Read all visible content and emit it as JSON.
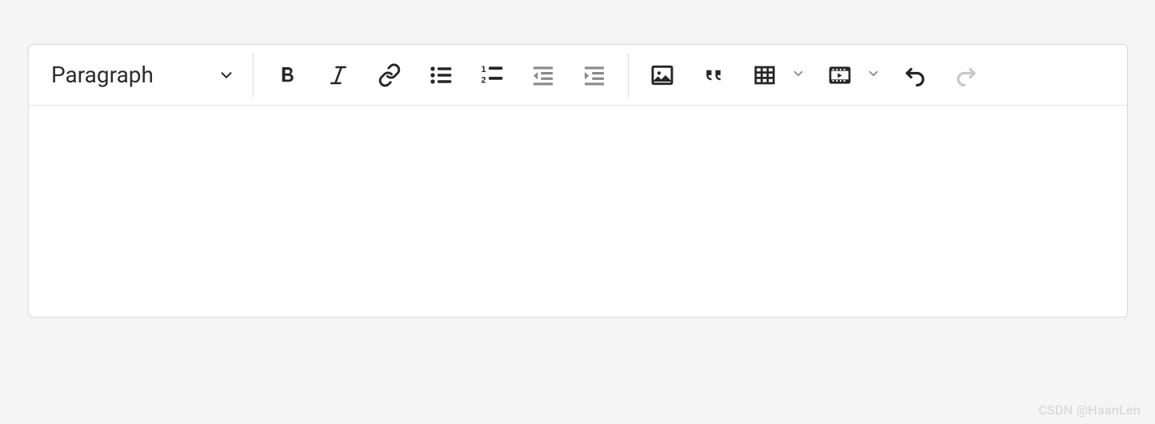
{
  "toolbar": {
    "block_format": {
      "label": "Paragraph",
      "icon": "chevron-down"
    },
    "buttons": {
      "bold": "Bold",
      "italic": "Italic",
      "link": "Insert link",
      "bullet_list": "Bulleted list",
      "numbered_list": "Numbered list",
      "outdent": "Decrease indent",
      "indent": "Increase indent",
      "image": "Insert image",
      "blockquote": "Blockquote",
      "table": "Insert table",
      "media": "Insert media",
      "undo": "Undo",
      "redo": "Redo"
    }
  },
  "editor": {
    "content": ""
  },
  "watermark": "CSDN @HaanLen",
  "colors": {
    "icon_dark": "#262626",
    "icon_light": "#8a8a8a",
    "border": "#d9d9d9"
  }
}
